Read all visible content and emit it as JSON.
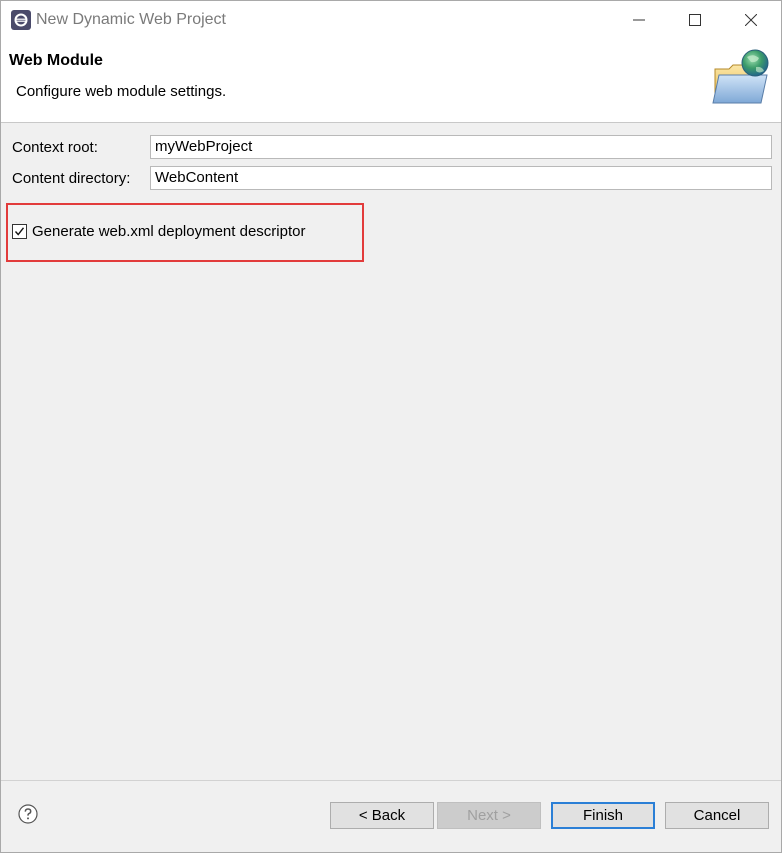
{
  "window": {
    "title": "New Dynamic Web Project",
    "icons": {
      "app": "eclipse-icon",
      "minimize": "minimize-icon",
      "maximize": "maximize-icon",
      "close": "close-icon"
    }
  },
  "banner": {
    "title": "Web Module",
    "description": "Configure web module settings.",
    "icon": "folder-globe-icon"
  },
  "form": {
    "context_root": {
      "label": "Context root:",
      "value": "myWebProject"
    },
    "content_directory": {
      "label": "Content directory:",
      "value": "WebContent"
    },
    "generate_descriptor": {
      "label": "Generate web.xml deployment descriptor",
      "checked": true
    }
  },
  "footer": {
    "help_icon": "help-icon",
    "back_label": "< Back",
    "next_label": "Next >",
    "finish_label": "Finish",
    "cancel_label": "Cancel"
  },
  "colors": {
    "highlight": "#e23b3b",
    "default_button_border": "#2b7fd6",
    "dialog_background": "#f0f0f0"
  }
}
